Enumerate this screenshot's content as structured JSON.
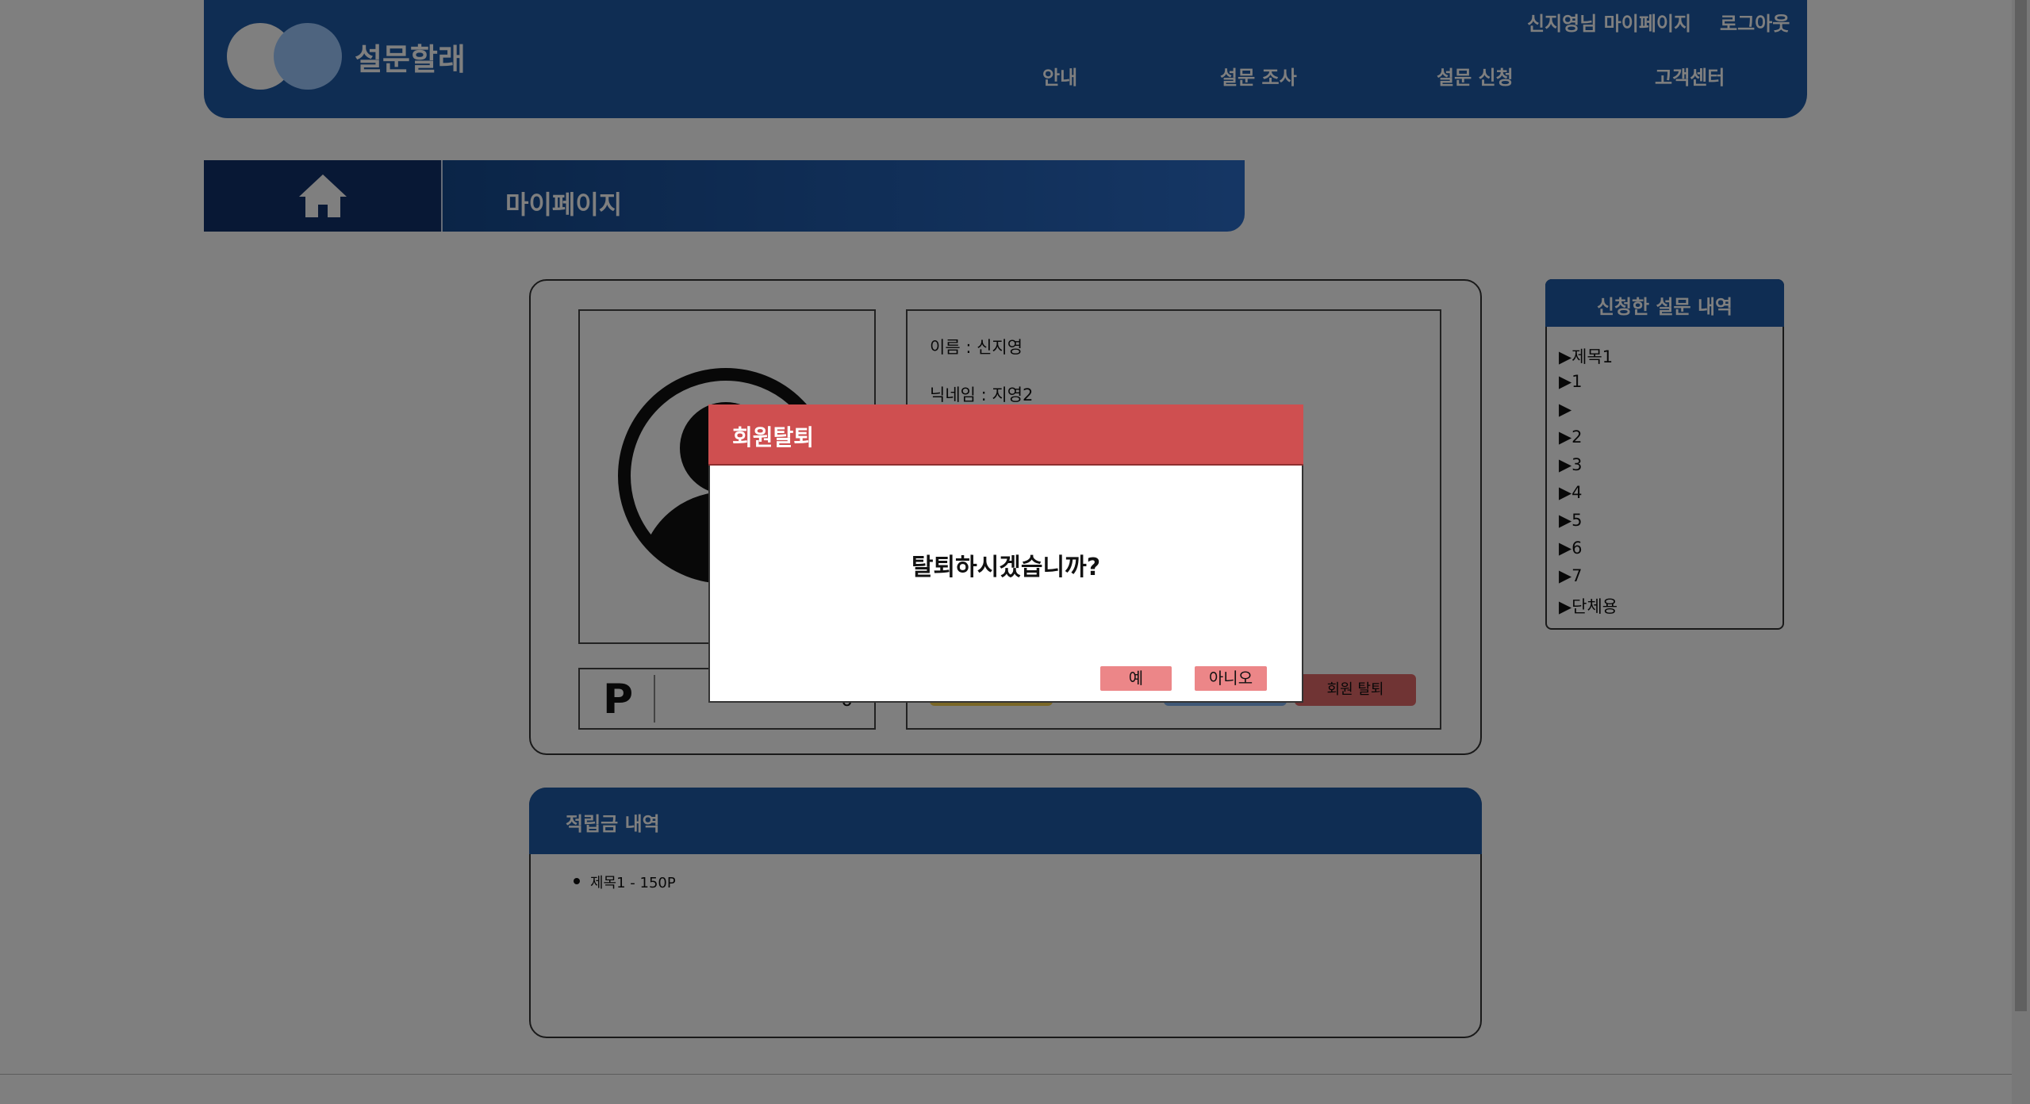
{
  "header": {
    "brand": "설문할래",
    "user_link": "신지영님 마이페이지",
    "logout": "로그아웃",
    "nav": [
      "안내",
      "설문 조사",
      "설문 신청",
      "고객센터"
    ]
  },
  "banner": {
    "title": "마이페이지",
    "home_icon": "home-icon"
  },
  "profile": {
    "avatar_icon": "user-avatar-icon",
    "points_symbol": "P",
    "points_value": "0",
    "name": "이름 : 신지영",
    "nickname": "닉네임 : 지영2",
    "withdraw_button": "회원 탈퇴"
  },
  "side_panel": {
    "title": "신청한 설문 내역",
    "items": [
      "▶제목1",
      "▶1",
      "▶",
      "▶2",
      "▶3",
      "▶4",
      "▶5",
      "▶6",
      "▶7",
      "▶단체용"
    ]
  },
  "rewards": {
    "title": "적립금 내역",
    "items": [
      "제목1 - 150P"
    ]
  },
  "modal": {
    "title": "회원탈퇴",
    "message": "탈퇴하시겠습니까?",
    "yes": "예",
    "no": "아니오"
  },
  "colors": {
    "primary": "#1f5aa6",
    "danger": "#cf4f50",
    "button_pink": "#ec8688"
  }
}
